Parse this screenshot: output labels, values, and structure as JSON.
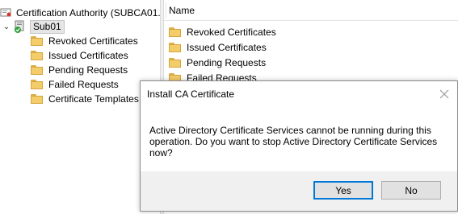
{
  "tree": {
    "root_label": "Certification Authority (SUBCA01.",
    "ca_node_label": "Sub01",
    "expander_glyph": "⌄",
    "children": [
      {
        "label": "Revoked Certificates"
      },
      {
        "label": "Issued Certificates"
      },
      {
        "label": "Pending Requests"
      },
      {
        "label": "Failed Requests"
      },
      {
        "label": "Certificate Templates"
      }
    ]
  },
  "list": {
    "column_name": "Name",
    "items": [
      {
        "label": "Revoked Certificates"
      },
      {
        "label": "Issued Certificates"
      },
      {
        "label": "Pending Requests"
      },
      {
        "label": "Failed Requests"
      }
    ]
  },
  "dialog": {
    "title": "Install CA Certificate",
    "message": "Active Directory Certificate Services cannot be running during this operation. Do you want to stop Active Directory Certificate Services now?",
    "yes_label": "Yes",
    "no_label": "No"
  },
  "colors": {
    "folder": "#f3cd6a",
    "accent": "#0078d7",
    "selection": "#e5e5e5"
  },
  "icons": {
    "root": "certificate-authority-icon",
    "ca": "ca-server-running-icon",
    "folder": "folder-icon",
    "close": "close-icon"
  }
}
